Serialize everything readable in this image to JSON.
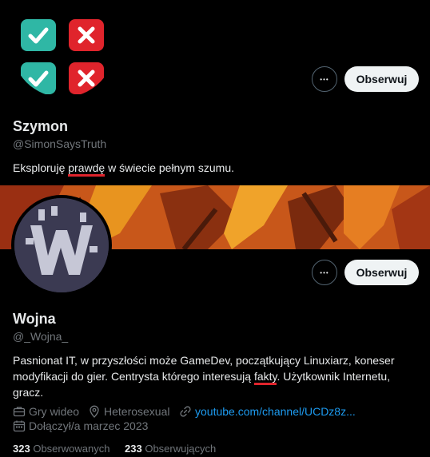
{
  "profile1": {
    "name": "Szymon",
    "handle": "@SimonSaysTruth",
    "bio_before": "Eksploruję ",
    "bio_highlight": "prawdę",
    "bio_after": " w świecie pełnym szumu.",
    "follow_label": "Obserwuj",
    "more_label": "•••"
  },
  "profile2": {
    "name": "Wojna",
    "handle": "@_Wojna_",
    "bio_line1": "Pasnionat IT, w przyszłości może GameDev, początkujący Linuxiarz, koneser",
    "bio_line2_before": "modyfikacji do gier. Centrysta którego interesują ",
    "bio_line2_highlight": "fakty",
    "bio_line2_after": ". Użytkownik Internetu,",
    "bio_line3": "gracz.",
    "category": "Gry wideo",
    "location": "Heterosexual",
    "url": "youtube.com/channel/UCDz8z...",
    "joined": "Dołączył/a marzec 2023",
    "following_count": "323",
    "following_label": "Obserwowanych",
    "followers_count": "233",
    "followers_label": "Obserwujących",
    "follow_label": "Obserwuj",
    "more_label": "•••"
  },
  "colors": {
    "accent_red": "#e0242c",
    "check_teal": "#2fb7a5",
    "link_blue": "#1d9bf0"
  }
}
